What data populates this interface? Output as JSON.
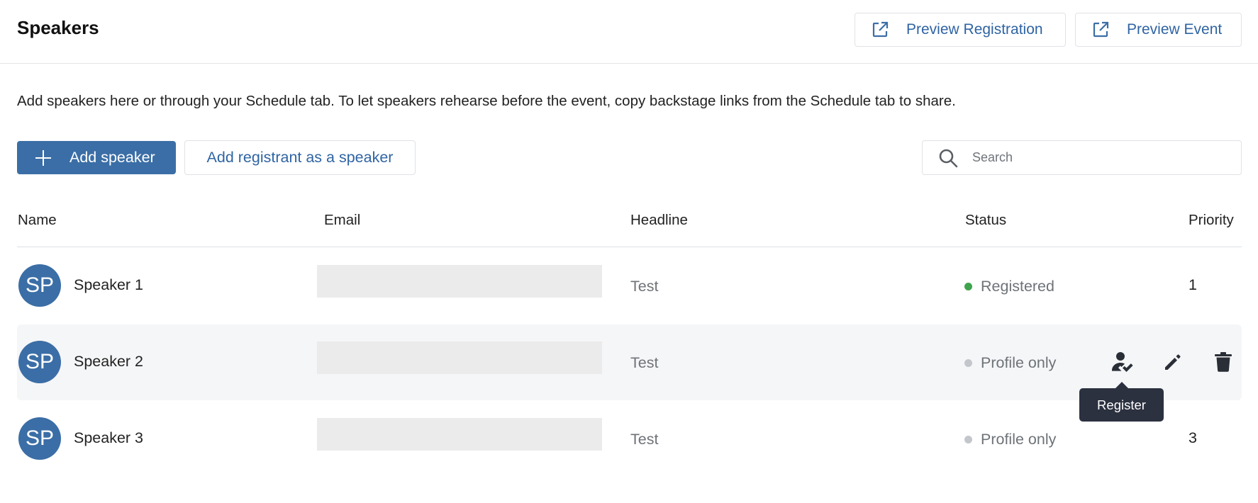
{
  "header": {
    "title": "Speakers",
    "preview_registration": "Preview Registration",
    "preview_event": "Preview Event"
  },
  "intro_text": "Add speakers here or through your Schedule tab. To let speakers rehearse before the event, copy backstage links from the Schedule tab to share.",
  "toolbar": {
    "add_speaker": "Add speaker",
    "add_registrant": "Add registrant as a speaker",
    "search_placeholder": "Search"
  },
  "table": {
    "columns": [
      "Name",
      "Email",
      "Headline",
      "Status",
      "Priority"
    ],
    "rows": [
      {
        "initials": "SP",
        "name": "Speaker 1",
        "headline": "Test",
        "status": "Registered",
        "status_color": "#3fa34d",
        "priority": "1"
      },
      {
        "initials": "SP",
        "name": "Speaker 2",
        "headline": "Test",
        "status": "Profile only",
        "status_color": "#c3c6cb",
        "priority": ""
      },
      {
        "initials": "SP",
        "name": "Speaker 3",
        "headline": "Test",
        "status": "Profile only",
        "status_color": "#c3c6cb",
        "priority": "3"
      }
    ]
  },
  "row_actions": {
    "icons": [
      "register-icon",
      "edit-icon",
      "delete-icon"
    ],
    "tooltip": "Register"
  },
  "colors": {
    "accent": "#3b6ea6",
    "link": "#2f64a3",
    "tooltip_bg": "#2c3140"
  }
}
